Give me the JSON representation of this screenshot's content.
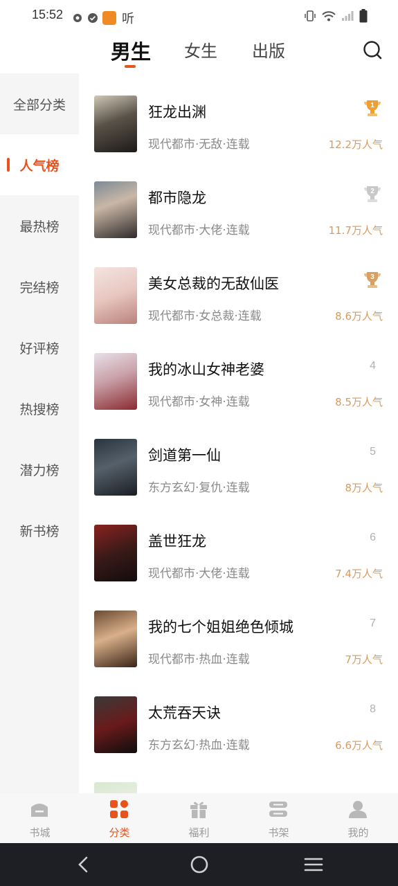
{
  "status_bar": {
    "time": "15:52",
    "left_icons": [
      "gear-icon",
      "check-circle-icon",
      "app-icon"
    ],
    "ting_label": "听",
    "right_icons": [
      "vibrate-icon",
      "wifi-icon",
      "signal-icon",
      "battery-icon"
    ]
  },
  "top_tabs": [
    {
      "label": "男生",
      "active": true
    },
    {
      "label": "女生",
      "active": false
    },
    {
      "label": "出版",
      "active": false
    }
  ],
  "search_icon": "search-icon",
  "sidebar": {
    "items": [
      {
        "label": "全部分类"
      },
      {
        "label": "人气榜",
        "active": true
      },
      {
        "label": "最热榜"
      },
      {
        "label": "完结榜"
      },
      {
        "label": "好评榜"
      },
      {
        "label": "热搜榜"
      },
      {
        "label": "潜力榜"
      },
      {
        "label": "新书榜"
      }
    ]
  },
  "books": [
    {
      "title": "狂龙出渊",
      "meta": "现代都市·无敌·连载",
      "popularity": "12.2万人气",
      "rank": "1",
      "rank_icon": "gold-trophy-icon"
    },
    {
      "title": "都市隐龙",
      "meta": "现代都市·大佬·连载",
      "popularity": "11.7万人气",
      "rank": "2",
      "rank_icon": "silver-trophy-icon"
    },
    {
      "title": "美女总裁的无敌仙医",
      "meta": "现代都市·女总裁·连载",
      "popularity": "8.6万人气",
      "rank": "3",
      "rank_icon": "bronze-trophy-icon"
    },
    {
      "title": "我的冰山女神老婆",
      "meta": "现代都市·女神·连载",
      "popularity": "8.5万人气",
      "rank": "4"
    },
    {
      "title": "剑道第一仙",
      "meta": "东方玄幻·复仇·连载",
      "popularity": "8万人气",
      "rank": "5"
    },
    {
      "title": "盖世狂龙",
      "meta": "现代都市·大佬·连载",
      "popularity": "7.4万人气",
      "rank": "6"
    },
    {
      "title": "我的七个姐姐绝色倾城",
      "meta": "现代都市·热血·连载",
      "popularity": "7万人气",
      "rank": "7"
    },
    {
      "title": "太荒吞天诀",
      "meta": "东方玄幻·热血·连载",
      "popularity": "6.6万人气",
      "rank": "8"
    }
  ],
  "bottom_nav": [
    {
      "label": "书城",
      "icon": "bookstore-icon"
    },
    {
      "label": "分类",
      "icon": "category-icon",
      "active": true
    },
    {
      "label": "福利",
      "icon": "gift-icon"
    },
    {
      "label": "书架",
      "icon": "bookshelf-icon"
    },
    {
      "label": "我的",
      "icon": "user-icon"
    }
  ],
  "colors": {
    "accent": "#e8531d",
    "popularity": "#d99a5a",
    "gold": "#f0a030",
    "silver": "#c8c8c8",
    "bronze": "#d9a060"
  },
  "system_nav": [
    "back-icon",
    "home-icon",
    "recents-icon"
  ]
}
